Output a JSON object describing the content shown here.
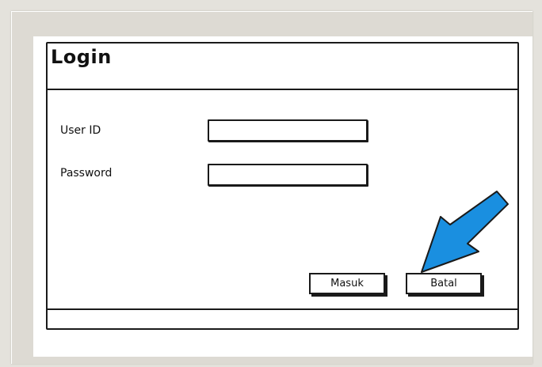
{
  "form": {
    "title": "Login",
    "user_id_label": "User ID",
    "password_label": "Password",
    "user_id_value": "",
    "password_value": ""
  },
  "buttons": {
    "submit_label": "Masuk",
    "cancel_label": "Batal"
  },
  "colors": {
    "arrow_fill": "#1a8fe0",
    "outline": "#1a1a1a",
    "frame": "#dddad3"
  },
  "annotation": {
    "icon": "pointer-arrow-icon"
  }
}
